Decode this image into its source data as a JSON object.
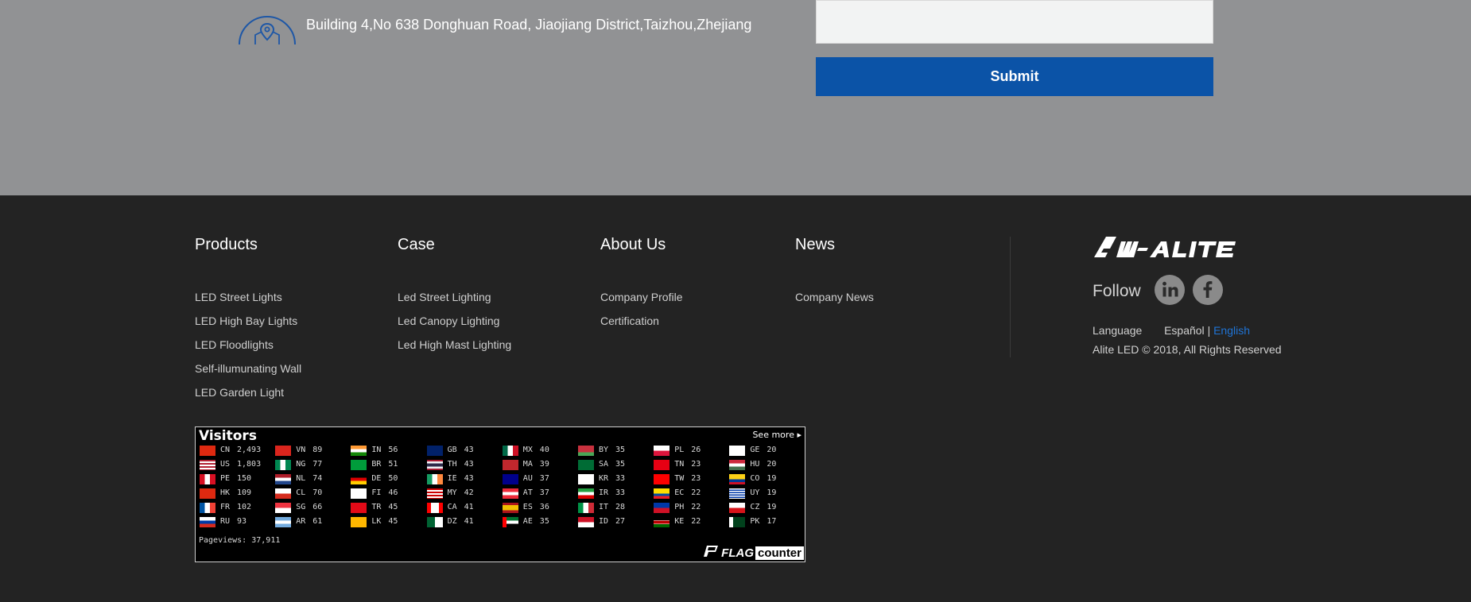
{
  "contact": {
    "address": "Building 4,No 638 Donghuan Road, Jiaojiang District,Taizhou,Zhejiang",
    "submit_label": "Submit"
  },
  "footer": {
    "columns": [
      {
        "title": "Products",
        "links": [
          "LED Street Lights",
          "LED High Bay Lights",
          "LED Floodlights",
          "Self-illumunating Wall",
          "LED Garden Light"
        ]
      },
      {
        "title": "Case",
        "links": [
          "Led Street Lighting",
          "Led Canopy Lighting",
          "Led High Mast Lighting"
        ]
      },
      {
        "title": "About Us",
        "links": [
          "Company Profile",
          "Certification"
        ]
      },
      {
        "title": "News",
        "links": [
          "Company News"
        ]
      }
    ],
    "brand": {
      "logo_text": "AI-ALITE",
      "follow_label": "Follow",
      "social": [
        "linkedin-icon",
        "facebook-icon"
      ],
      "language_label": "Language",
      "languages": [
        {
          "label": "Español",
          "active": false
        },
        {
          "label": "English",
          "active": true
        }
      ],
      "language_separator": "|",
      "copyright": "Alite LED © 2018, All Rights Reserved"
    }
  },
  "colors": {
    "top_bg": "#919294",
    "footer_bg": "#232323",
    "submit_bg": "#0b53a7",
    "link_active": "#1f74d6"
  },
  "flag_counter": {
    "title": "Visitors",
    "see_more": "See more",
    "pageviews_label": "Pageviews:",
    "pageviews": "37,911",
    "brand_flag": "FLAG",
    "brand_counter": "counter",
    "countries": [
      {
        "code": "CN",
        "count": "2,493"
      },
      {
        "code": "US",
        "count": "1,803"
      },
      {
        "code": "PE",
        "count": "150"
      },
      {
        "code": "HK",
        "count": "109"
      },
      {
        "code": "FR",
        "count": "102"
      },
      {
        "code": "RU",
        "count": "93"
      },
      {
        "code": "VN",
        "count": "89"
      },
      {
        "code": "NG",
        "count": "77"
      },
      {
        "code": "NL",
        "count": "74"
      },
      {
        "code": "CL",
        "count": "70"
      },
      {
        "code": "SG",
        "count": "66"
      },
      {
        "code": "AR",
        "count": "61"
      },
      {
        "code": "IN",
        "count": "56"
      },
      {
        "code": "BR",
        "count": "51"
      },
      {
        "code": "DE",
        "count": "50"
      },
      {
        "code": "FI",
        "count": "46"
      },
      {
        "code": "TR",
        "count": "45"
      },
      {
        "code": "LK",
        "count": "45"
      },
      {
        "code": "GB",
        "count": "43"
      },
      {
        "code": "TH",
        "count": "43"
      },
      {
        "code": "IE",
        "count": "43"
      },
      {
        "code": "MY",
        "count": "42"
      },
      {
        "code": "CA",
        "count": "41"
      },
      {
        "code": "DZ",
        "count": "41"
      },
      {
        "code": "MX",
        "count": "40"
      },
      {
        "code": "MA",
        "count": "39"
      },
      {
        "code": "AU",
        "count": "37"
      },
      {
        "code": "AT",
        "count": "37"
      },
      {
        "code": "ES",
        "count": "36"
      },
      {
        "code": "AE",
        "count": "35"
      },
      {
        "code": "BY",
        "count": "35"
      },
      {
        "code": "SA",
        "count": "35"
      },
      {
        "code": "KR",
        "count": "33"
      },
      {
        "code": "IR",
        "count": "33"
      },
      {
        "code": "IT",
        "count": "28"
      },
      {
        "code": "ID",
        "count": "27"
      },
      {
        "code": "PL",
        "count": "26"
      },
      {
        "code": "TN",
        "count": "23"
      },
      {
        "code": "TW",
        "count": "23"
      },
      {
        "code": "EC",
        "count": "22"
      },
      {
        "code": "PH",
        "count": "22"
      },
      {
        "code": "KE",
        "count": "22"
      },
      {
        "code": "GE",
        "count": "20"
      },
      {
        "code": "HU",
        "count": "20"
      },
      {
        "code": "CO",
        "count": "19"
      },
      {
        "code": "UY",
        "count": "19"
      },
      {
        "code": "CZ",
        "count": "19"
      },
      {
        "code": "PK",
        "count": "17"
      }
    ]
  }
}
